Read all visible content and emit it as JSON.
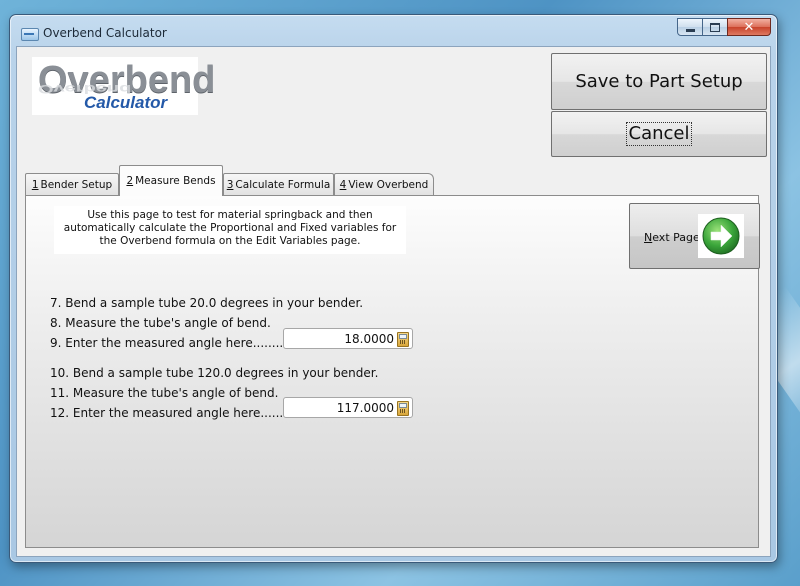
{
  "window": {
    "title": "Overbend Calculator",
    "close_glyph": "✕"
  },
  "logo": {
    "word1": "Overbend",
    "word2": "Calculator"
  },
  "buttons": {
    "save": "Save to Part Setup",
    "cancel": "Cancel"
  },
  "tabs": [
    {
      "num": "1",
      "label": "Bender Setup"
    },
    {
      "num": "2",
      "label": "Measure Bends"
    },
    {
      "num": "3",
      "label": "Calculate Formula"
    },
    {
      "num": "4",
      "label": "View Overbend"
    }
  ],
  "active_tab": 1,
  "instructions": {
    "line1": "Use this page to test for material springback and then",
    "line2": "automatically calculate the Proportional and Fixed variables for",
    "line3": "the Overbend formula on the Edit Variables page."
  },
  "next_page": {
    "label_first": "N",
    "label_rest": "ext Page",
    "icon": "green-arrow-right-icon"
  },
  "steps": {
    "s7": "7. Bend a sample tube 20.0 degrees in your bender.",
    "s8": "8. Measure the tube's angle of bend.",
    "s9": "9. Enter the measured angle here........",
    "s10": "10. Bend a sample tube 120.0 degrees in your bender.",
    "s11": "11. Measure the tube's angle of bend.",
    "s12": "12. Enter the measured angle here........"
  },
  "fields": {
    "angle1": "18.0000",
    "angle2": "117.0000"
  },
  "colors": {
    "arrow_green": "#3aa53a",
    "logo_blue": "#2459a8"
  }
}
